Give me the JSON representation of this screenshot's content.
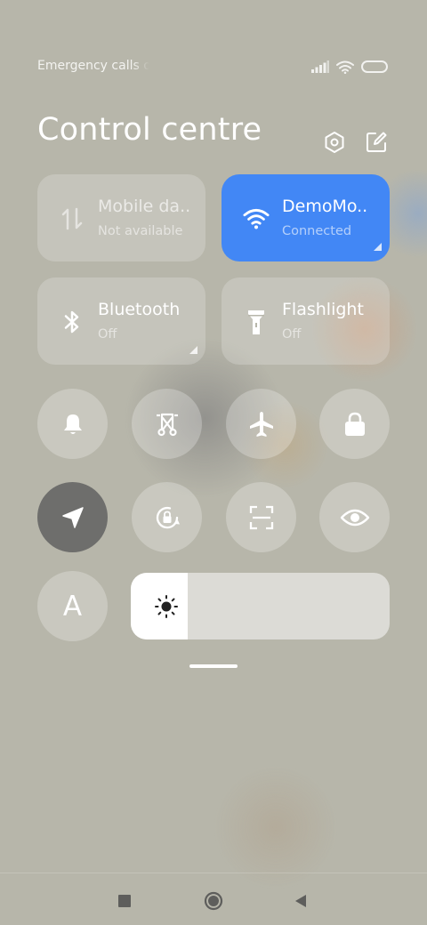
{
  "status_bar": {
    "carrier_text": "Emergency calls o",
    "icons": [
      "signal-icon",
      "wifi-icon",
      "battery-icon"
    ]
  },
  "header": {
    "title": "Control centre",
    "buttons": [
      "settings-icon",
      "edit-icon"
    ]
  },
  "tiles": [
    {
      "id": "mobile-data",
      "label": "Mobile da..",
      "sub": "Not available",
      "state": "disabled",
      "icon": "mobile-data-icon"
    },
    {
      "id": "wifi",
      "label": "DemoMo..",
      "sub": "Connected",
      "state": "active",
      "icon": "wifi-icon"
    },
    {
      "id": "bluetooth",
      "label": "Bluetooth",
      "sub": "Off",
      "state": "off",
      "icon": "bluetooth-icon"
    },
    {
      "id": "flashlight",
      "label": "Flashlight",
      "sub": "Off",
      "state": "off",
      "icon": "flashlight-icon"
    }
  ],
  "toggles": [
    {
      "id": "sound",
      "icon": "bell-icon",
      "on": false
    },
    {
      "id": "screenshot",
      "icon": "scissors-icon",
      "on": false
    },
    {
      "id": "airplane-mode",
      "icon": "airplane-icon",
      "on": false
    },
    {
      "id": "lock-screen",
      "icon": "lock-icon",
      "on": false
    },
    {
      "id": "location",
      "icon": "location-arrow-icon",
      "on": true
    },
    {
      "id": "rotation-lock",
      "icon": "rotation-lock-icon",
      "on": false
    },
    {
      "id": "scanner",
      "icon": "scan-icon",
      "on": false
    },
    {
      "id": "reading-mode",
      "icon": "eye-icon",
      "on": false
    },
    {
      "id": "auto-brightness",
      "icon": "auto-brightness-icon",
      "on": false
    }
  ],
  "auto_brightness_letter": "A",
  "brightness": {
    "level": 0.22,
    "icon": "sun-icon"
  },
  "nav": [
    "recents-square-icon",
    "home-circle-icon",
    "back-triangle-icon"
  ],
  "colors": {
    "accent": "#4287f5",
    "active_toggle": "#6e6e6c",
    "background": "#b7b6aa"
  }
}
